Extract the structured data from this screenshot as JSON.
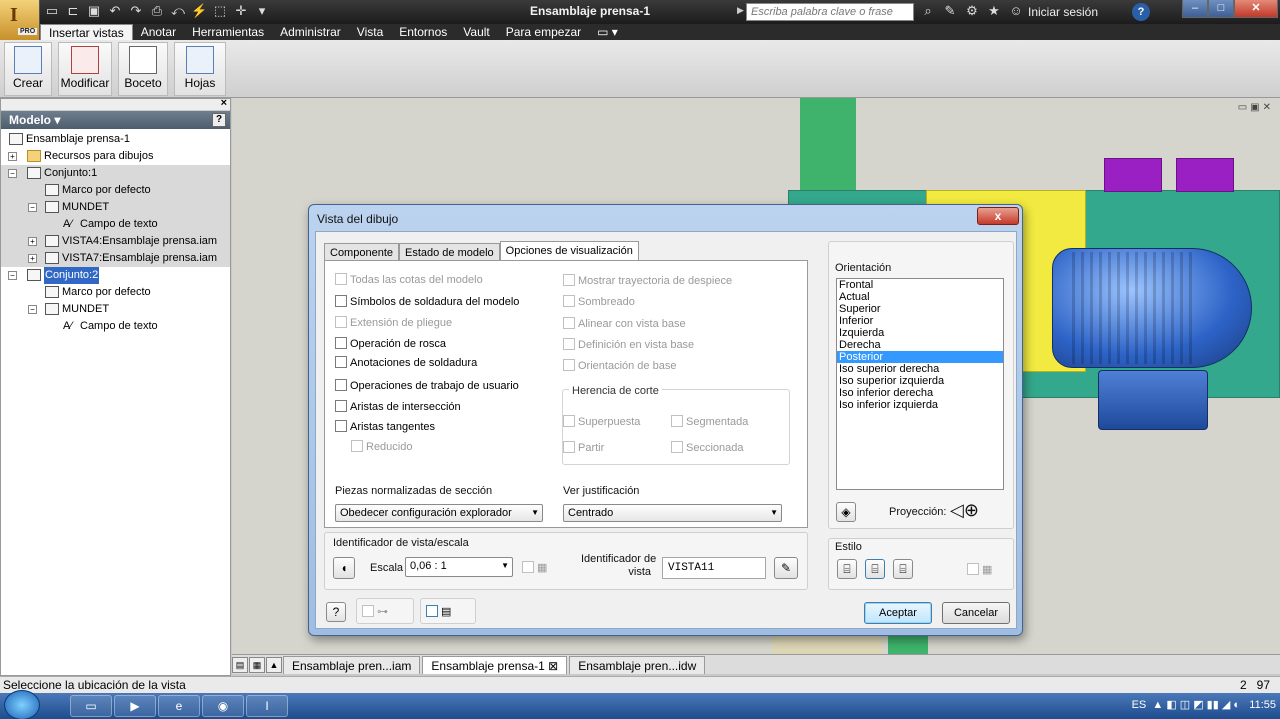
{
  "app": {
    "title": "Ensamblaje prensa-1",
    "logo_letter": "I",
    "logo_badge": "PRO",
    "search_placeholder": "Escriba palabra clave o frase",
    "signin": "Iniciar sesión",
    "help": "?"
  },
  "ribbon": {
    "tabs": [
      "Insertar vistas",
      "Anotar",
      "Herramientas",
      "Administrar",
      "Vista",
      "Entornos",
      "Vault",
      "Para empezar"
    ],
    "buttons": [
      "Crear",
      "Modificar",
      "Boceto",
      "Hojas"
    ]
  },
  "browser": {
    "title": "Modelo ▾",
    "help": "?",
    "items": [
      "Ensamblaje prensa-1",
      "Recursos para dibujos",
      "Conjunto:1",
      "Marco por defecto",
      "MUNDET",
      "Campo de texto",
      "VISTA4:Ensamblaje prensa.iam",
      "VISTA7:Ensamblaje prensa.iam",
      "Conjunto:2",
      "Marco por defecto",
      "MUNDET",
      "Campo de texto"
    ]
  },
  "dialog": {
    "title": "Vista del dibujo",
    "close": "x",
    "tabs": [
      "Componente",
      "Estado de modelo",
      "Opciones de visualización"
    ],
    "left_checks": [
      {
        "label": "Todas las cotas del modelo",
        "checked": false,
        "disabled": true
      },
      {
        "label": "Símbolos de soldadura del modelo",
        "checked": false,
        "disabled": false
      },
      {
        "label": "Extensión de pliegue",
        "checked": false,
        "disabled": true
      },
      {
        "label": "Operación de rosca",
        "checked": false,
        "disabled": false
      },
      {
        "label": "Anotaciones de soldadura",
        "checked": false,
        "disabled": false
      },
      {
        "label": "Operaciones de trabajo de usuario",
        "checked": false,
        "disabled": false
      },
      {
        "label": "Aristas de intersección",
        "checked": false,
        "disabled": false
      },
      {
        "label": "Aristas tangentes",
        "checked": false,
        "disabled": false
      },
      {
        "label": "Reducido",
        "checked": false,
        "disabled": true
      }
    ],
    "right_checks": [
      {
        "label": "Mostrar trayectoria de despiece",
        "checked": false,
        "disabled": true
      },
      {
        "label": "Sombreado",
        "checked": false,
        "disabled": true
      },
      {
        "label": "Alinear con vista base",
        "checked": false,
        "disabled": true
      },
      {
        "label": "Definición en vista base",
        "checked": false,
        "disabled": true
      },
      {
        "label": "Orientación de base",
        "checked": false,
        "disabled": true
      }
    ],
    "herencia": {
      "title": "Herencia de corte",
      "options": [
        "Superpuesta",
        "Segmentada",
        "Partir",
        "Seccionada"
      ]
    },
    "piezas_label": "Piezas normalizadas de sección",
    "piezas_value": "Obedecer configuración explorador",
    "justif_label": "Ver justificación",
    "justif_value": "Centrado",
    "ident_group": "Identificador de vista/escala",
    "escala_label": "Escala",
    "escala_value": "0,06 : 1",
    "ident_label_1": "Identificador de",
    "ident_label_2": "vista",
    "ident_value": "VISTA11",
    "orientation": {
      "title": "Orientación",
      "items": [
        "Frontal",
        "Actual",
        "Superior",
        "Inferior",
        "Izquierda",
        "Derecha",
        "Posterior",
        "Iso superior derecha",
        "Iso superior izquierda",
        "Iso inferior derecha",
        "Iso inferior izquierda"
      ],
      "selected": "Posterior",
      "projection_label": "Proyección:"
    },
    "estilo": "Estilo",
    "ok": "Aceptar",
    "cancel": "Cancelar",
    "help": "?"
  },
  "doc_tabs": [
    "Ensamblaje pren...iam",
    "Ensamblaje prensa-1",
    "Ensamblaje pren...idw"
  ],
  "doc_tab_active": "Ensamblaje prensa-1",
  "status": {
    "text": "Seleccione la ubicación de la vista",
    "num_a": "2",
    "num_b": "97"
  },
  "taskbar": {
    "lang": "ES",
    "clock": "11:55"
  },
  "colors": {
    "selection": "#3399ff",
    "tree_selection": "#3168c6",
    "drawing_green": "#3fb36b",
    "drawing_teal": "#34a88c",
    "drawing_yellow": "#f2ea40",
    "motor_blue": "#2d63c7",
    "purple": "#9a20c4"
  }
}
